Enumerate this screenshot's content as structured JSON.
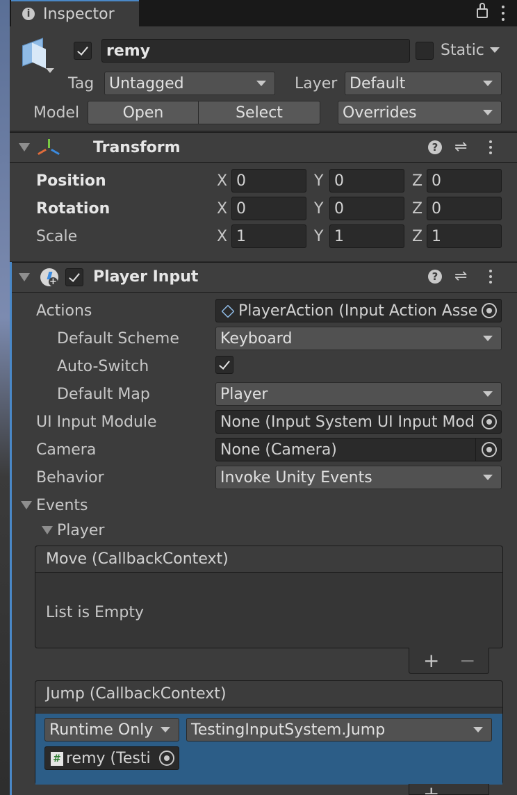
{
  "tab": {
    "title": "Inspector"
  },
  "object": {
    "name": "remy",
    "active": true,
    "static_label": "Static",
    "static": false
  },
  "tag": {
    "label": "Tag",
    "value": "Untagged"
  },
  "layer": {
    "label": "Layer",
    "value": "Default"
  },
  "model": {
    "label": "Model",
    "open": "Open",
    "select": "Select",
    "overrides": "Overrides"
  },
  "transform": {
    "title": "Transform",
    "rows": [
      {
        "label": "Position",
        "x": "0",
        "y": "0",
        "z": "0"
      },
      {
        "label": "Rotation",
        "x": "0",
        "y": "0",
        "z": "0"
      },
      {
        "label": "Scale",
        "x": "1",
        "y": "1",
        "z": "1"
      }
    ],
    "axis": {
      "x": "X",
      "y": "Y",
      "z": "Z"
    }
  },
  "player_input": {
    "title": "Player Input",
    "enabled": true,
    "actions": {
      "label": "Actions",
      "value": "PlayerAction (Input Action Asse"
    },
    "default_scheme": {
      "label": "Default Scheme",
      "value": "Keyboard"
    },
    "auto_switch": {
      "label": "Auto-Switch",
      "value": true
    },
    "default_map": {
      "label": "Default Map",
      "value": "Player"
    },
    "ui_input_module": {
      "label": "UI Input Module",
      "value": "None (Input System UI Input Mod"
    },
    "camera": {
      "label": "Camera",
      "value": "None (Camera)"
    },
    "behavior": {
      "label": "Behavior",
      "value": "Invoke Unity Events"
    }
  },
  "events": {
    "label": "Events",
    "group": "Player",
    "move": {
      "title": "Move (CallbackContext)",
      "empty": "List is Empty",
      "add": "+",
      "remove": "−"
    },
    "jump": {
      "title": "Jump (CallbackContext)",
      "runtime": "Runtime Only",
      "function": "TestingInputSystem.Jump",
      "target": "remy (Testi",
      "add": "+"
    }
  },
  "colors": {
    "accent": "#4a88c7",
    "selected_row": "#2c5d87"
  }
}
